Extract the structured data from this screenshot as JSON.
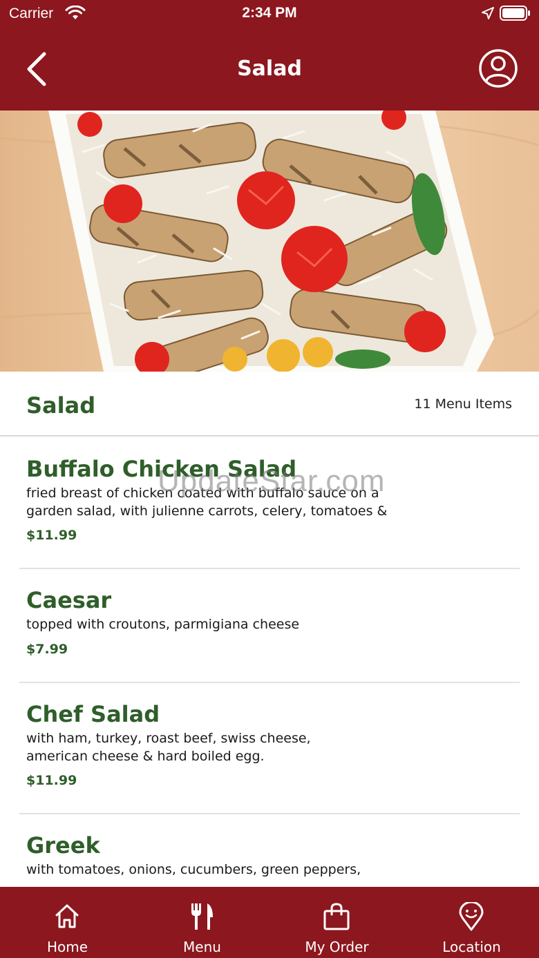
{
  "status_bar": {
    "carrier": "Carrier",
    "time": "2:34 PM"
  },
  "header": {
    "title": "Salad"
  },
  "section": {
    "title": "Salad",
    "count": "11 Menu Items"
  },
  "items": [
    {
      "name": "Buffalo Chicken Salad",
      "description": "fried breast of chicken coated with buffalo sauce on a garden salad, with julienne carrots, celery, tomatoes &",
      "price": "$11.99"
    },
    {
      "name": "Caesar",
      "description": "topped with croutons, parmigiana cheese",
      "price": "$7.99"
    },
    {
      "name": "Chef Salad",
      "description": "with ham, turkey, roast beef, swiss cheese, american cheese & hard boiled egg.",
      "price": "$11.99"
    },
    {
      "name": "Greek",
      "description": "with tomatoes, onions, cucumbers, green peppers,",
      "price": ""
    }
  ],
  "watermark": "UpdateStar.com",
  "tabs": [
    {
      "label": "Home",
      "icon": "home-icon"
    },
    {
      "label": "Menu",
      "icon": "fork-knife-icon"
    },
    {
      "label": "My Order",
      "icon": "shopping-bag-icon"
    },
    {
      "label": "Location",
      "icon": "location-pin-icon"
    }
  ],
  "colors": {
    "brand_red": "#8c171e",
    "accent_green": "#2f5e2a"
  }
}
